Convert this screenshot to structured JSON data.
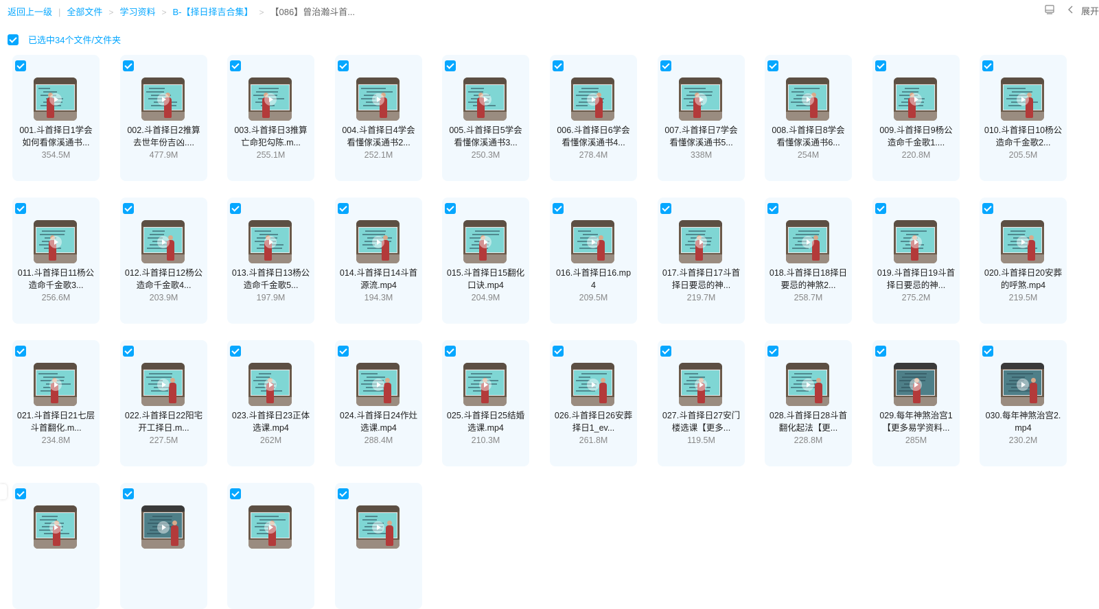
{
  "breadcrumb": {
    "back": "返回上一级",
    "items": [
      "全部文件",
      "学习资料",
      "B-【择日择吉合集】"
    ],
    "current": "【086】曾治瀚斗首..."
  },
  "toolbar": {
    "expand_label": "展开",
    "layout_icon": "panel-icon",
    "collapse_icon": "chevron-left-icon"
  },
  "selection": {
    "text": "已选中34个文件/文件夹"
  },
  "accent": "#06a7ff",
  "files": [
    {
      "name": "001.斗首择日1学会如何看傢溪通书...",
      "size": "354.5M"
    },
    {
      "name": "002.斗首择日2推算去世年份吉凶....",
      "size": "477.9M"
    },
    {
      "name": "003.斗首择日3推算亡命犯勾陈.m...",
      "size": "255.1M"
    },
    {
      "name": "004.斗首择日4学会看懂傢溪通书2...",
      "size": "252.1M"
    },
    {
      "name": "005.斗首择日5学会看懂傢溪通书3...",
      "size": "250.3M"
    },
    {
      "name": "006.斗首择日6学会看懂傢溪通书4...",
      "size": "278.4M"
    },
    {
      "name": "007.斗首择日7学会看懂傢溪通书5...",
      "size": "338M"
    },
    {
      "name": "008.斗首择日8学会看懂傢溪通书6...",
      "size": "254M"
    },
    {
      "name": "009.斗首择日9杨公造命千金歌1....",
      "size": "220.8M"
    },
    {
      "name": "010.斗首择日10杨公造命千金歌2...",
      "size": "205.5M"
    },
    {
      "name": "011.斗首择日11杨公造命千金歌3...",
      "size": "256.6M"
    },
    {
      "name": "012.斗首择日12杨公造命千金歌4...",
      "size": "203.9M"
    },
    {
      "name": "013.斗首择日13杨公造命千金歌5...",
      "size": "197.9M"
    },
    {
      "name": "014.斗首择日14斗首源流.mp4",
      "size": "194.3M"
    },
    {
      "name": "015.斗首择日15翻化口诀.mp4",
      "size": "204.9M"
    },
    {
      "name": "016.斗首择日16.mp4",
      "size": "209.5M"
    },
    {
      "name": "017.斗首择日17斗首择日要忌的神...",
      "size": "219.7M"
    },
    {
      "name": "018.斗首择日18择日要忌的神煞2...",
      "size": "258.7M"
    },
    {
      "name": "019.斗首择日19斗首择日要忌的神...",
      "size": "275.2M"
    },
    {
      "name": "020.斗首择日20安葬的呼煞.mp4",
      "size": "219.5M"
    },
    {
      "name": "021.斗首择日21七层斗首翻化.m...",
      "size": "234.8M"
    },
    {
      "name": "022.斗首择日22阳宅开工择日.m...",
      "size": "227.5M"
    },
    {
      "name": "023.斗首择日23正体选课.mp4",
      "size": "262M"
    },
    {
      "name": "024.斗首择日24作灶选课.mp4",
      "size": "288.4M"
    },
    {
      "name": "025.斗首择日25结婚选课.mp4",
      "size": "210.3M"
    },
    {
      "name": "026.斗首择日26安葬择日1_ev...",
      "size": "261.8M"
    },
    {
      "name": "027.斗首择日27安门楼选课【更多...",
      "size": "119.5M"
    },
    {
      "name": "028.斗首择日28斗首翻化起法【更...",
      "size": "228.8M"
    },
    {
      "name": "029.每年神煞治宫1【更多易学资料...",
      "size": "285M"
    },
    {
      "name": "030.每年神煞治宫2.mp4",
      "size": "230.2M"
    },
    {
      "name": "",
      "size": ""
    },
    {
      "name": "",
      "size": ""
    },
    {
      "name": "",
      "size": ""
    },
    {
      "name": "",
      "size": ""
    }
  ]
}
